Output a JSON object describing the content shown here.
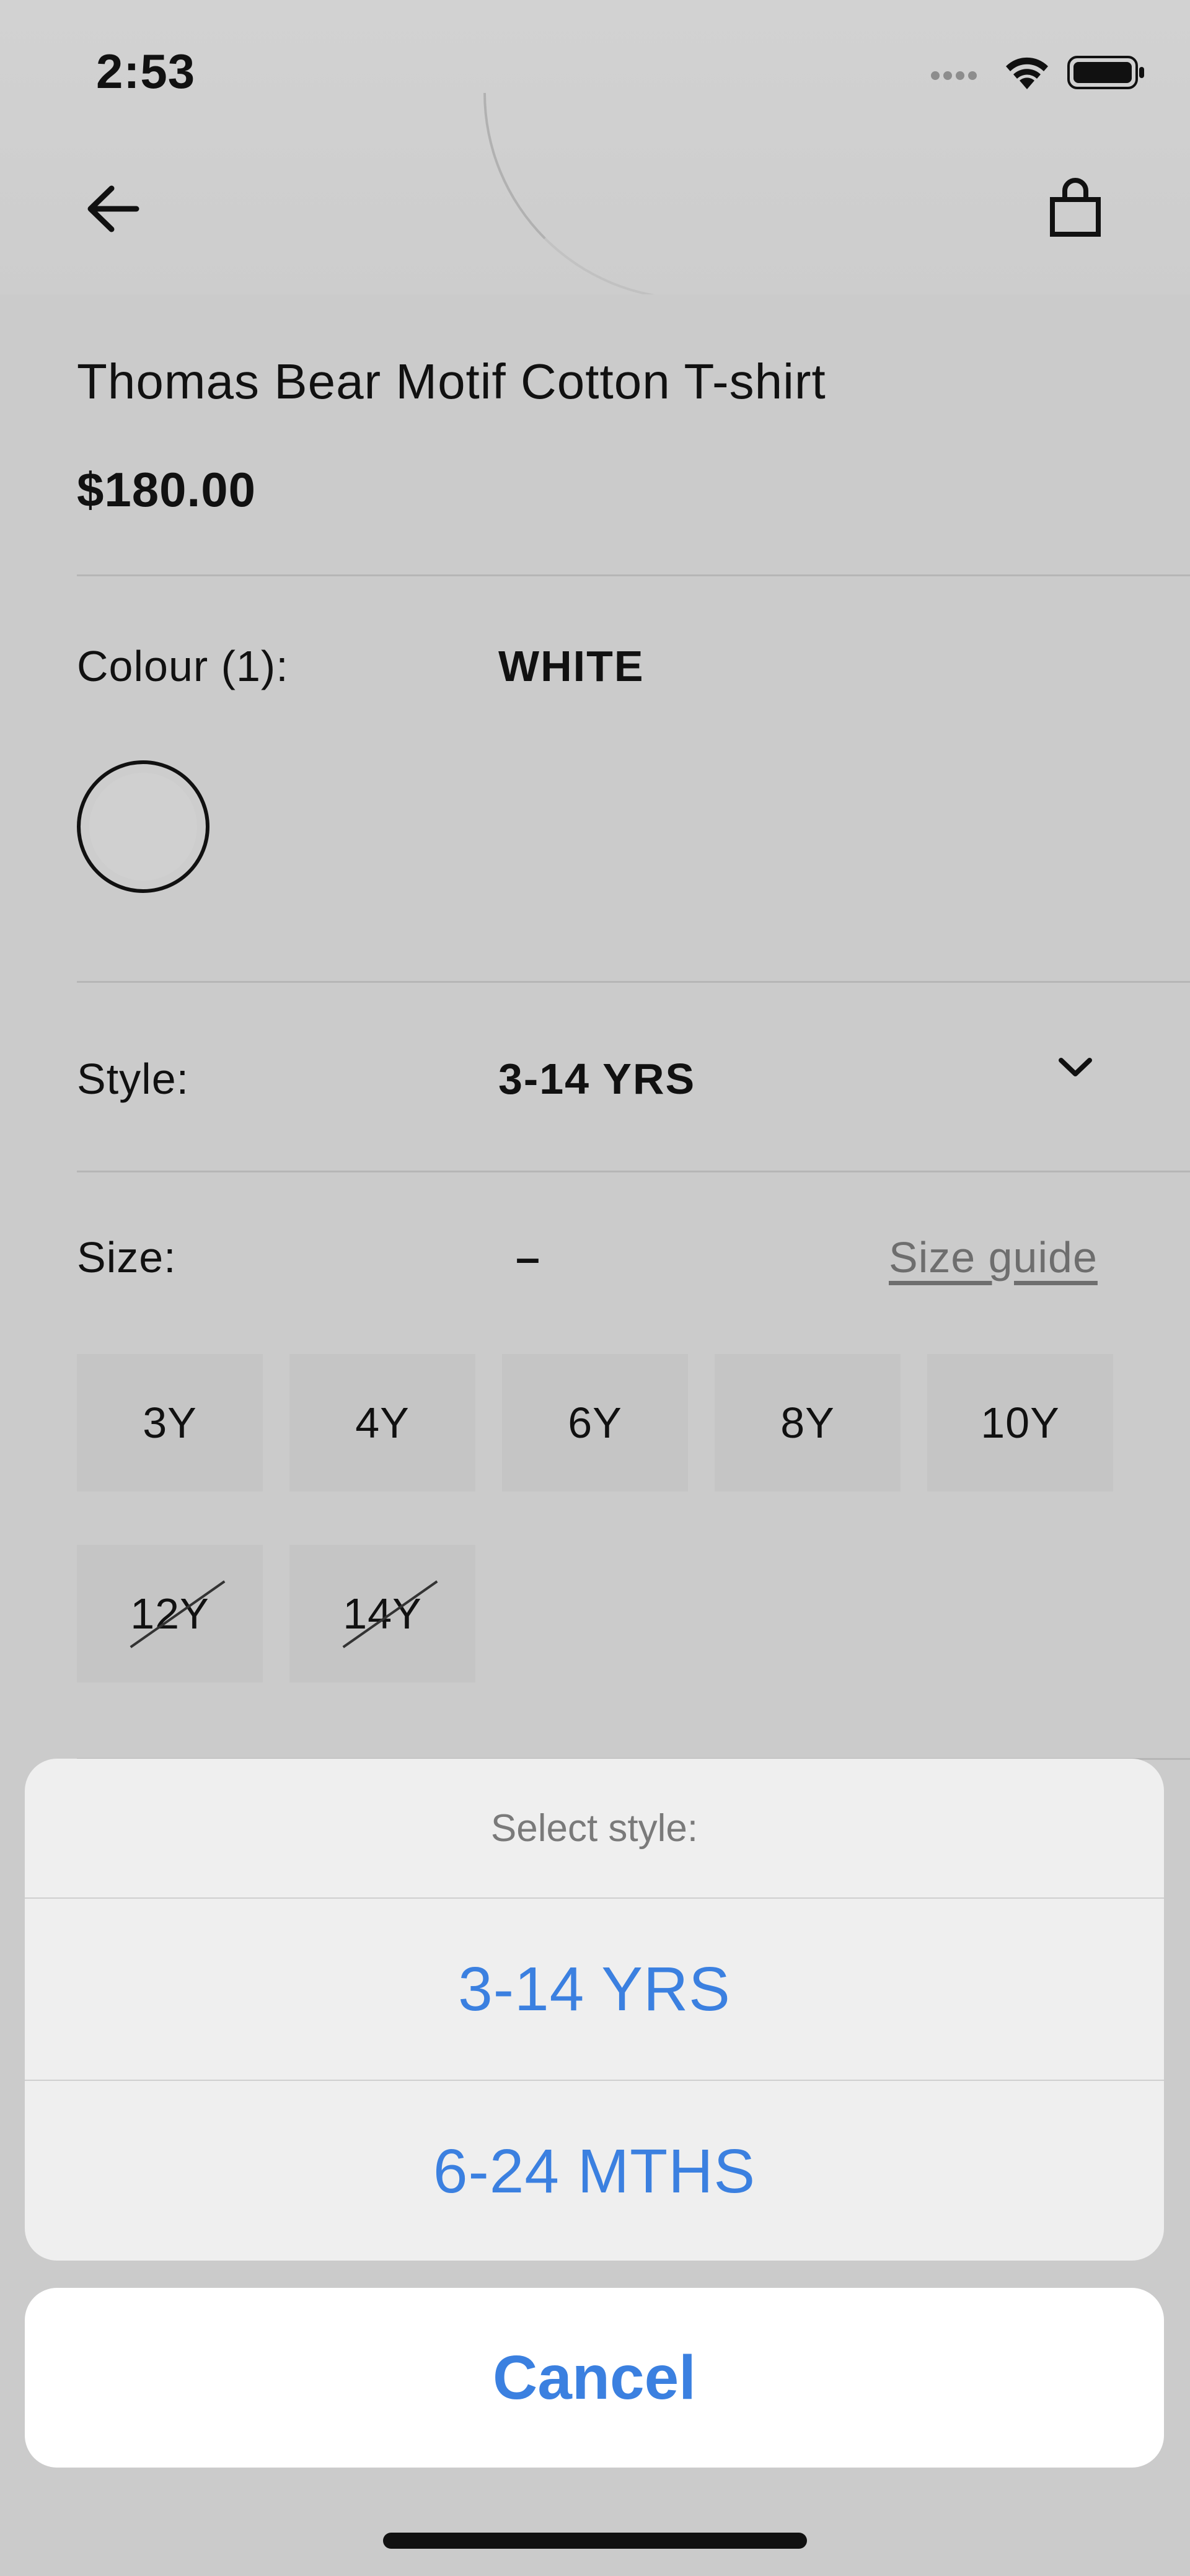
{
  "status_bar": {
    "time": "2:53"
  },
  "colors": {
    "accent": "#3b80e0",
    "background": "#cbcbcb",
    "sheet": "#efefef"
  },
  "icons": {
    "back": "arrow-left-icon",
    "bag": "shopping-bag-icon",
    "wifi": "wifi-icon",
    "battery": "battery-icon",
    "chevron": "chevron-down-icon"
  },
  "product": {
    "title": "Thomas Bear Motif Cotton T-shirt",
    "price": "$180.00"
  },
  "colour": {
    "label": "Colour (1):",
    "value": "WHITE"
  },
  "style": {
    "label": "Style:",
    "value": "3-14 YRS"
  },
  "size": {
    "label": "Size:",
    "value": "–",
    "guide_link": "Size guide",
    "options": [
      {
        "label": "3Y",
        "available": true
      },
      {
        "label": "4Y",
        "available": true
      },
      {
        "label": "6Y",
        "available": true
      },
      {
        "label": "8Y",
        "available": true
      },
      {
        "label": "10Y",
        "available": true
      },
      {
        "label": "12Y",
        "available": false
      },
      {
        "label": "14Y",
        "available": false
      }
    ]
  },
  "action_sheet": {
    "title": "Select style:",
    "options": [
      "3-14 YRS",
      "6-24 MTHS"
    ],
    "cancel": "Cancel"
  }
}
